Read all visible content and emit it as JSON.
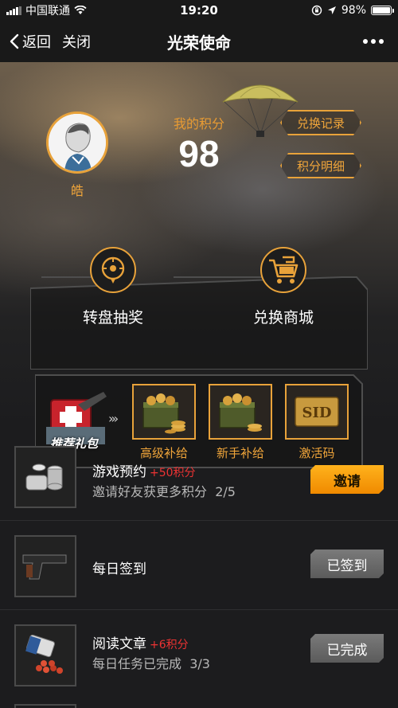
{
  "status_bar": {
    "carrier": "中国联通",
    "time": "19:20",
    "battery": "98%",
    "battery_level": 0.98,
    "icons": [
      "signal-icon",
      "wifi-icon",
      "lock-rotation-icon",
      "location-icon",
      "battery-icon"
    ]
  },
  "nav": {
    "back_label": "返回",
    "close_label": "关闭",
    "title": "光荣使命",
    "more_icon": "more-dots-icon"
  },
  "profile": {
    "name": "皓",
    "points_label": "我的积分",
    "points": "98",
    "exchange_record_label": "兑换记录",
    "points_detail_label": "积分明细"
  },
  "features": [
    {
      "label": "转盘抽奖",
      "icon": "lottery-wheel-icon"
    },
    {
      "label": "兑换商城",
      "icon": "shopping-cart-icon"
    }
  ],
  "gift": {
    "title": "推荐礼包",
    "items": [
      {
        "label": "高级补给",
        "icon": "ammo-box-coins-icon"
      },
      {
        "label": "新手补给",
        "icon": "ammo-box-coins-icon"
      },
      {
        "label": "激活码",
        "icon": "sid-card-icon"
      }
    ]
  },
  "tasks": [
    {
      "title": "游戏预约",
      "bonus": "+50积分",
      "subtitle": "邀请好友获更多积分",
      "progress": "2/5",
      "button": "邀请",
      "button_state": "active",
      "icon": "coin-stacks-icon"
    },
    {
      "title": "每日签到",
      "bonus": "",
      "subtitle": "",
      "progress": "",
      "button": "已签到",
      "button_state": "done",
      "icon": "pistol-icon"
    },
    {
      "title": "阅读文章",
      "bonus": "+6积分",
      "subtitle": "每日任务已完成",
      "progress": "3/3",
      "button": "已完成",
      "button_state": "done",
      "icon": "pill-bottle-icon"
    }
  ],
  "colors": {
    "accent": "#e8a23a",
    "invite_button": "#f59a0a",
    "done_button": "#6b6b6b",
    "bonus_text": "#e33333",
    "background": "#1c1c1e"
  }
}
